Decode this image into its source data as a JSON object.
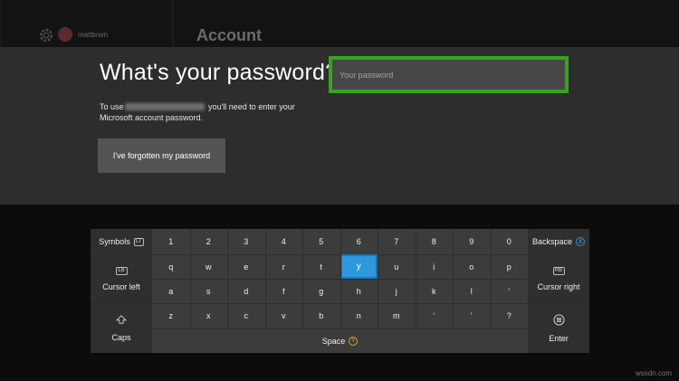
{
  "header": {
    "username": "mattbrwn",
    "section_title": "Account"
  },
  "dialog": {
    "title": "What's your password?",
    "password_placeholder": "Your password",
    "description_pre": "To use",
    "description_post": "you'll need to enter your",
    "description_line2": "Microsoft account password.",
    "forgot_label": "I've forgotten my password"
  },
  "keyboard": {
    "symbols_label": "Symbols",
    "symbols_badge": "LT",
    "cursor_left_label": "Cursor left",
    "cursor_left_badge": "LB",
    "caps_label": "Caps",
    "backspace_label": "Backspace",
    "backspace_badge": "X",
    "cursor_right_label": "Cursor right",
    "cursor_right_badge": "RB",
    "enter_label": "Enter",
    "space_label": "Space",
    "space_badge": "Y",
    "row1": [
      "1",
      "2",
      "3",
      "4",
      "5",
      "6",
      "7",
      "8",
      "9",
      "0"
    ],
    "row2": [
      "q",
      "w",
      "e",
      "r",
      "t",
      "y",
      "u",
      "i",
      "o",
      "p"
    ],
    "row3": [
      "a",
      "s",
      "d",
      "f",
      "g",
      "h",
      "j",
      "k",
      "l",
      "'"
    ],
    "row4": [
      "z",
      "x",
      "c",
      "v",
      "b",
      "n",
      "m",
      "‘",
      "’",
      "?"
    ],
    "selected_key": "y"
  },
  "colors": {
    "focus": "#37a41b",
    "selected_key": "#2f97dc"
  },
  "watermark": "wsxdn.com"
}
